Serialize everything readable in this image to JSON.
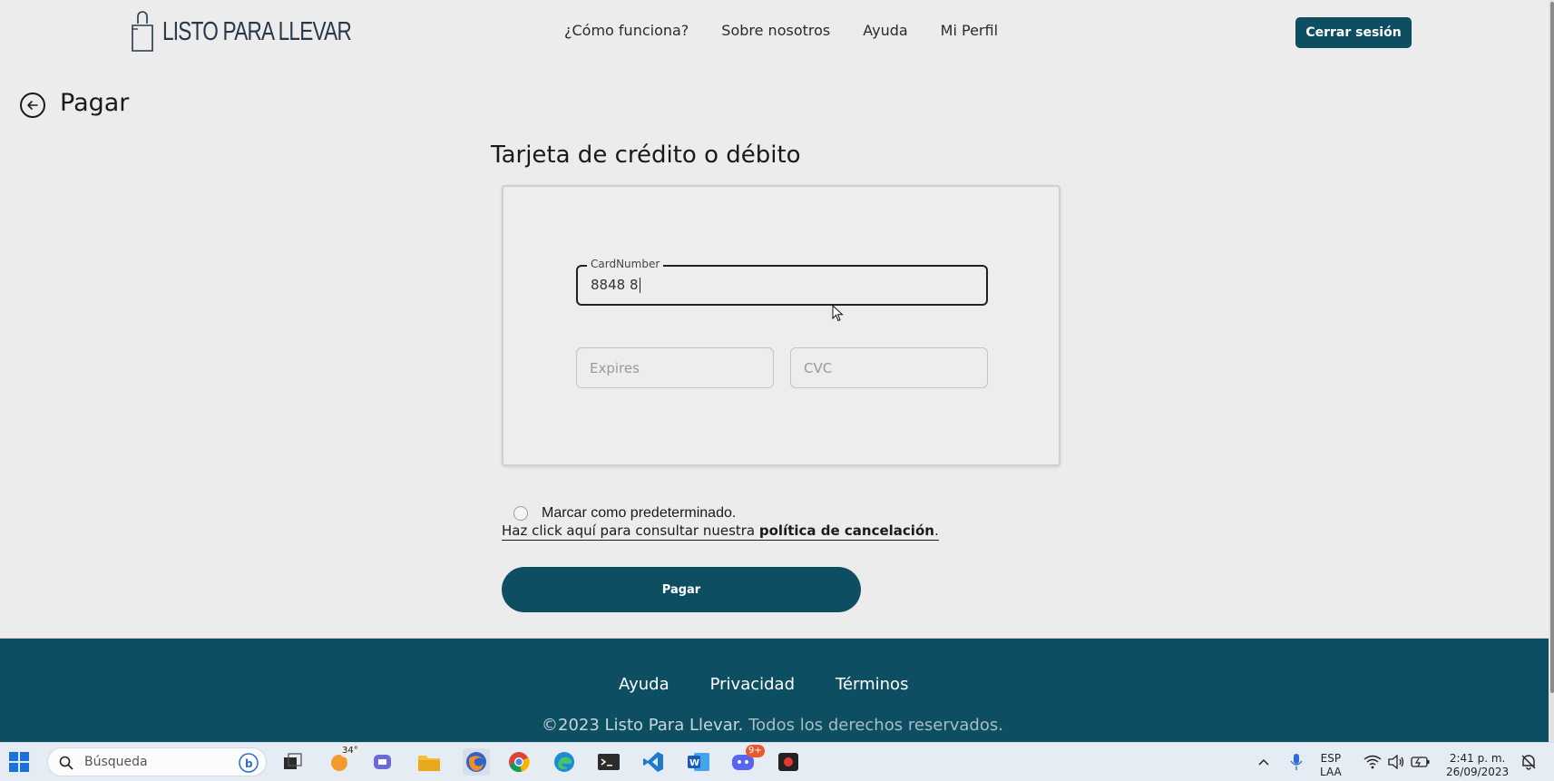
{
  "header": {
    "logo_text": "LISTO PARA LLEVAR",
    "nav": [
      "¿Cómo funciona?",
      "Sobre nosotros",
      "Ayuda",
      "Mi Perfil"
    ],
    "logout_label": "Cerrar sesión"
  },
  "page": {
    "title": "Pagar",
    "section_title": "Tarjeta de crédito o débito"
  },
  "card_form": {
    "card_number_label": "CardNumber",
    "card_number_value": "8848 8",
    "expires_placeholder": "Expires",
    "cvc_placeholder": "CVC"
  },
  "options": {
    "default_label": "Marcar como predeterminado.",
    "default_checked": false,
    "policy_prefix": "Haz click aquí para consultar nuestra ",
    "policy_link": "política de cancelación",
    "policy_suffix": "."
  },
  "pay_button": "Pagar",
  "footer": {
    "links": [
      "Ayuda",
      "Privacidad",
      "Términos"
    ],
    "copyright": "©2023 Listo Para Llevar.",
    "rights": "Todos los derechos reservados."
  },
  "taskbar": {
    "search_placeholder": "Búsqueda",
    "weather_badge": "34°",
    "discord_badge": "9+",
    "language_line1": "ESP",
    "language_line2": "LAA",
    "time": "2:41 p. m.",
    "date": "26/09/2023"
  },
  "colors": {
    "brand": "#0e4e63",
    "page_background": "#ececec"
  }
}
